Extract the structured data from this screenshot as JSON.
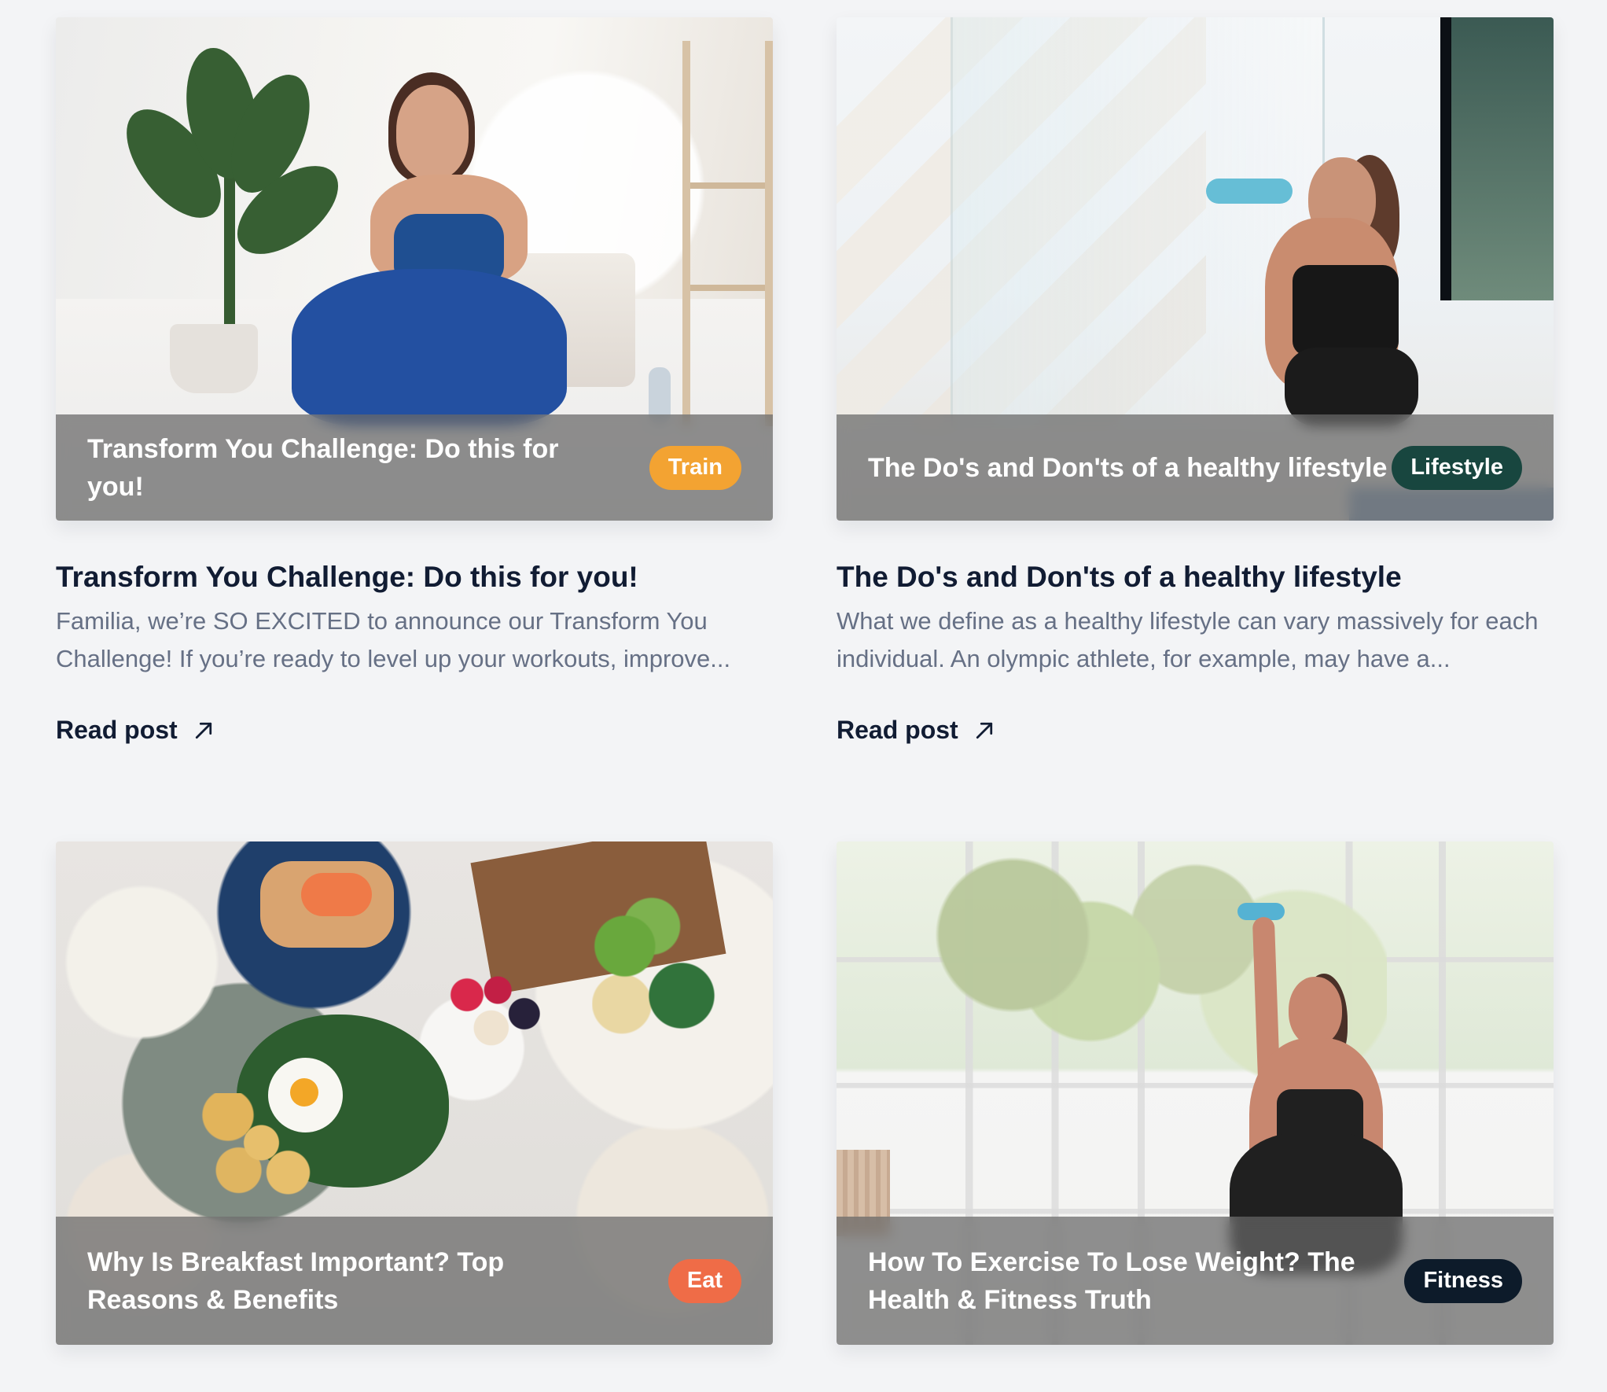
{
  "posts": [
    {
      "overlay_title": "Transform You Challenge: Do this for you!",
      "tag": "Train",
      "tag_color": "#f3a332",
      "title": "Transform You Challenge: Do this for you!",
      "excerpt": "Familia, we’re SO EXCITED to announce our Transform You Challenge! If you’re ready to level up your workouts, improve...",
      "read_more": "Read post"
    },
    {
      "overlay_title": "The Do's and Don'ts of a healthy lifestyle",
      "tag": "Lifestyle",
      "tag_color": "#18463f",
      "title": "The Do's and Don'ts of a healthy lifestyle",
      "excerpt": "What we define as a healthy lifestyle can vary massively for each individual. An olympic athlete, for example, may have a...",
      "read_more": "Read post"
    },
    {
      "overlay_title": "Why Is Breakfast Important? Top Reasons & Benefits",
      "tag": "Eat",
      "tag_color": "#ef6c47"
    },
    {
      "overlay_title": "How To Exercise To Lose Weight? The Health & Fitness Truth",
      "tag": "Fitness",
      "tag_color": "#0d1b2a"
    }
  ],
  "icons": {
    "read_post": "arrow-up-right-icon"
  },
  "colors": {
    "background": "#f3f4f6",
    "title": "#111c33",
    "excerpt": "#667085"
  }
}
